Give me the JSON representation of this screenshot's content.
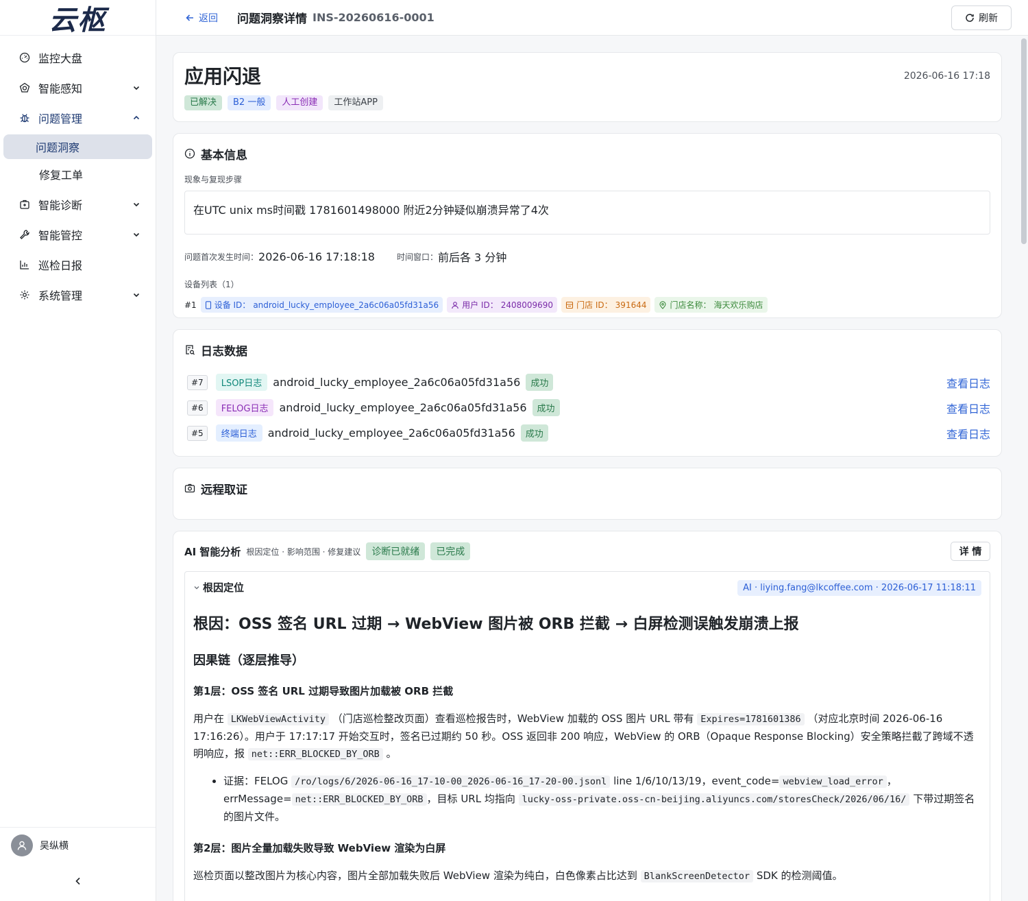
{
  "app": {
    "logo_text": "云枢"
  },
  "sidebar": {
    "items": [
      {
        "label": "监控大盘"
      },
      {
        "label": "智能感知"
      },
      {
        "label": "问题管理"
      },
      {
        "label": "智能诊断"
      },
      {
        "label": "智能管控"
      },
      {
        "label": "巡检日报"
      },
      {
        "label": "系统管理"
      }
    ],
    "sub_items": [
      {
        "label": "问题洞察"
      },
      {
        "label": "修复工单"
      }
    ],
    "user_name": "吴纵横"
  },
  "header": {
    "back_label": "返回",
    "title": "问题洞察详情",
    "id": "INS-20260616-0001",
    "refresh_label": "刷新"
  },
  "issue": {
    "title": "应用闪退",
    "timestamp": "2026-06-16 17:18",
    "tags": {
      "status": "已解决",
      "level": "B2 一般",
      "source": "人工创建",
      "app": "工作站APP"
    }
  },
  "basic": {
    "heading": "基本信息",
    "desc_label": "现象与复现步骤",
    "desc_value": "在UTC unix ms时间戳 1781601498000 附近2分钟疑似崩溃异常了4次",
    "first_time_label": "问题首次发生时间：",
    "first_time_value": "2026-06-16 17:18:18",
    "window_label": "时间窗口：",
    "window_value": "前后各 3 分钟",
    "device_list_label": "设备列表（1）",
    "device": {
      "index": "#1",
      "device_label": "设备 ID：",
      "device_value": "android_lucky_employee_2a6c06a05fd31a56",
      "user_label": "用户 ID：",
      "user_value": "2408009690",
      "shop_label": "门店 ID：",
      "shop_value": "391644",
      "shop_name_label": "门店名称：",
      "shop_name_value": "海天欢乐购店"
    }
  },
  "logs": {
    "heading": "日志数据",
    "view_label": "查看日志",
    "rows": [
      {
        "num": "#7",
        "type": "LSOP日志",
        "device": "android_lucky_employee_2a6c06a05fd31a56",
        "status": "成功"
      },
      {
        "num": "#6",
        "type": "FELOG日志",
        "device": "android_lucky_employee_2a6c06a05fd31a56",
        "status": "成功"
      },
      {
        "num": "#5",
        "type": "终端日志",
        "device": "android_lucky_employee_2a6c06a05fd31a56",
        "status": "成功"
      }
    ]
  },
  "remote": {
    "heading": "远程取证"
  },
  "ai": {
    "title": "AI 智能分析",
    "subtitle": "根因定位 · 影响范围 · 修复建议",
    "tag1": "诊断已就绪",
    "tag2": "已完成",
    "detail_label": "详 情",
    "section_label": "根因定位",
    "meta": "AI · liying.fang@lkcoffee.com · 2026-06-17 11:18:11",
    "h1": "根因：OSS 签名 URL 过期 → WebView 图片被 ORB 拦截 → 白屏检测误触发崩溃上报",
    "h2": "因果链（逐层推导）",
    "layer1_title": "第1层：OSS 签名 URL 过期导致图片加载被 ORB 拦截",
    "p1_a": "用户在",
    "p1_code1": "LKWebViewActivity",
    "p1_b": "（门店巡检整改页面）查看巡检报告时，WebView 加载的 OSS 图片 URL 带有",
    "p1_code2": "Expires=1781601386",
    "p1_c": "（对应北京时间 2026-06-16 17:16:26）。用户于 17:17:17 开始交互时，签名已过期约 50 秒。OSS 返回非 200 响应，WebView 的 ORB（Opaque Response Blocking）安全策略拦截了跨域不透明响应，报",
    "p1_code3": "net::ERR_BLOCKED_BY_ORB",
    "p1_d": "。",
    "li1_a": "证据：FELOG",
    "li1_code1": "/ro/logs/6/2026-06-16_17-10-00_2026-06-16_17-20-00.jsonl",
    "li1_b": "line 1/6/10/13/19，event_code=",
    "li1_code2": "webview_load_error",
    "li1_c": "，errMessage=",
    "li1_code3": "net::ERR_BLOCKED_BY_ORB",
    "li1_d": "，目标 URL 均指向",
    "li1_code4": "lucky-oss-private.oss-cn-beijing.aliyuncs.com/storesCheck/2026/06/16/",
    "li1_e": "下带过期签名的图片文件。",
    "layer2_title": "第2层：图片全量加载失败导致 WebView 渲染为白屏",
    "p2_a": "巡检页面以整改图片为核心内容，图片全部加载失败后 WebView 渲染为纯白，白色像素占比达到",
    "p2_code1": "BlankScreenDetector",
    "p2_b": "SDK 的检测阈值。"
  }
}
